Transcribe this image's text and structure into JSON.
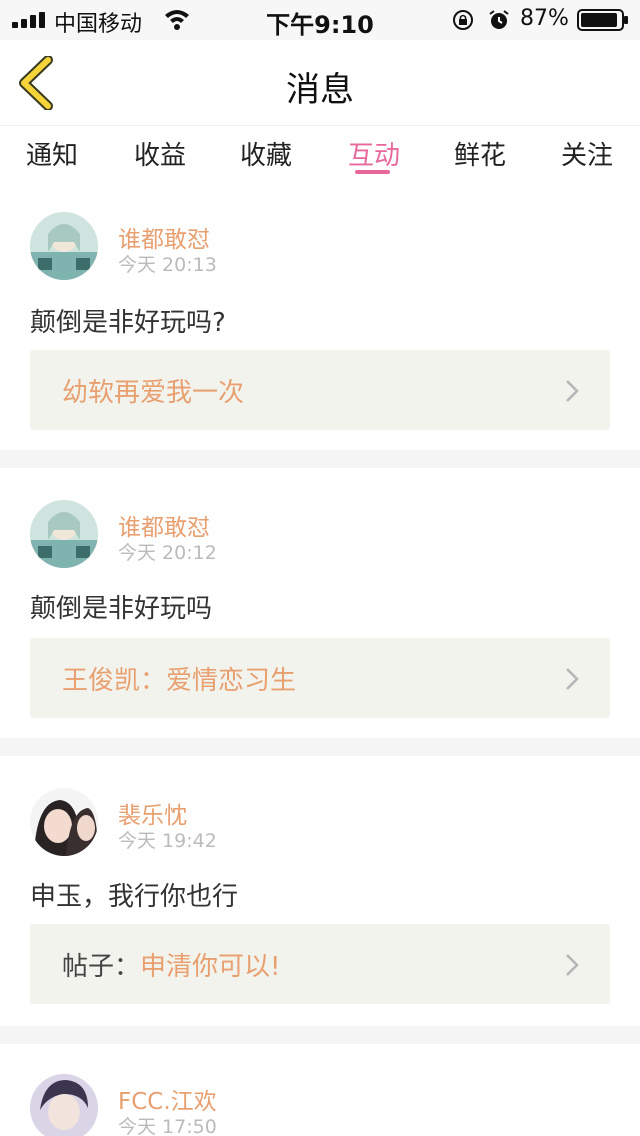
{
  "status_bar": {
    "carrier": "中国移动",
    "time": "下午9:10",
    "battery": "87%"
  },
  "nav": {
    "title": "消息",
    "back_icon": "chevron-left-icon"
  },
  "tabs": [
    {
      "label": "通知",
      "active": false
    },
    {
      "label": "收益",
      "active": false
    },
    {
      "label": "收藏",
      "active": false
    },
    {
      "label": "互动",
      "active": true
    },
    {
      "label": "鲜花",
      "active": false
    },
    {
      "label": "关注",
      "active": false
    }
  ],
  "messages": [
    {
      "user": "谁都敢怼",
      "time": "今天 20:13",
      "text": "颠倒是非好玩吗?",
      "link_prefix": "",
      "link": "幼软再爱我一次"
    },
    {
      "user": "谁都敢怼",
      "time": "今天 20:12",
      "text": "颠倒是非好玩吗",
      "link_prefix": "",
      "link": "王俊凯：爱情恋习生"
    },
    {
      "user": "裴乐忱",
      "time": "今天 19:42",
      "text": "申玉，我行你也行",
      "link_prefix": "帖子：",
      "link": "申清你可以!"
    },
    {
      "user": "FCC.江欢",
      "time": "今天 17:50"
    }
  ],
  "colors": {
    "accent_pink": "#e7689a",
    "username_orange": "#e8a070",
    "back_yellow": "#f5d43a"
  }
}
